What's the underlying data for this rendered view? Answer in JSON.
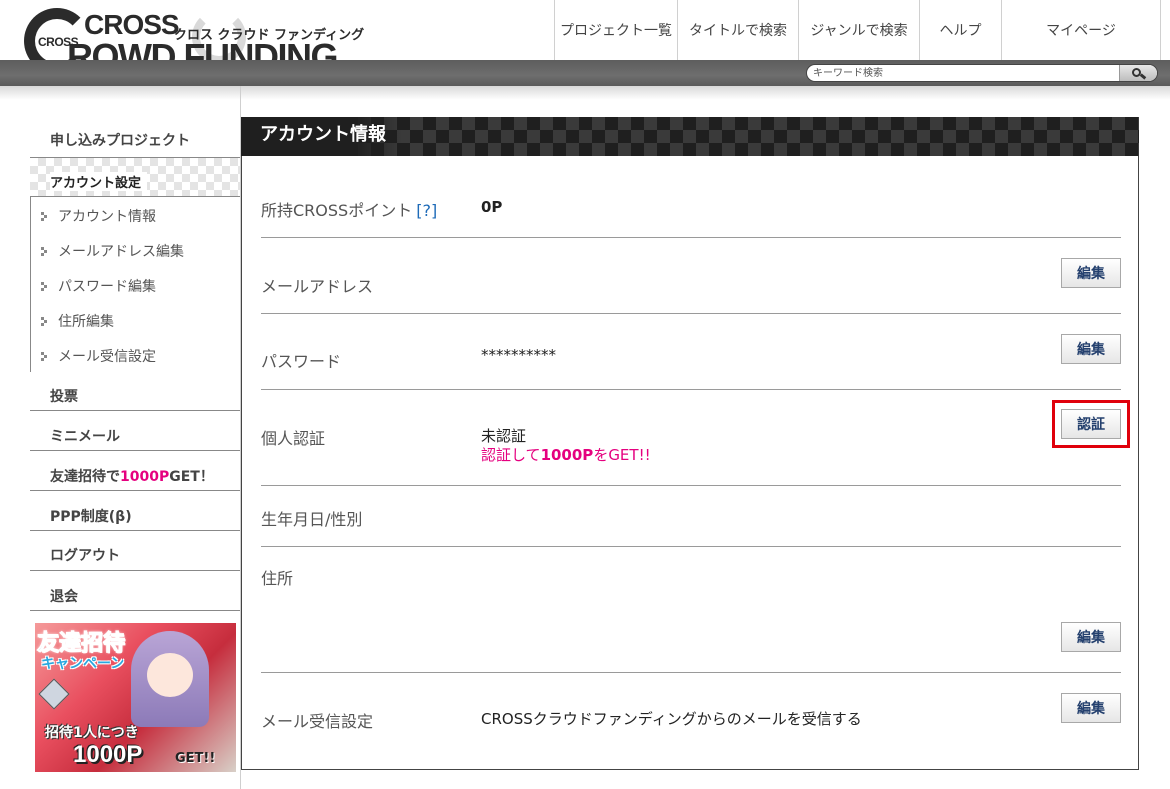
{
  "logo": {
    "badge": "CROSS",
    "line1": "CROSS",
    "line2": "ROWD FUNDING",
    "kana": "クロス クラウド ファンディング"
  },
  "global_nav": [
    {
      "label": "プロジェクト一覧"
    },
    {
      "label": "タイトルで検索"
    },
    {
      "label": "ジャンルで検索"
    },
    {
      "label": "ヘルプ"
    },
    {
      "label": "マイページ"
    }
  ],
  "search": {
    "placeholder": "キーワード検索",
    "button_icon": "search-icon"
  },
  "sidebar": {
    "applied_projects": "申し込みプロジェクト",
    "account_settings": "アカウント設定",
    "sub_items": [
      {
        "label": "アカウント情報"
      },
      {
        "label": "メールアドレス編集"
      },
      {
        "label": "パスワード編集"
      },
      {
        "label": "住所編集"
      },
      {
        "label": "メール受信設定"
      }
    ],
    "vote": "投票",
    "mini_mail": "ミニメール",
    "invite_prefix": "友達招待で",
    "invite_points": "1000P",
    "invite_suffix": "GET！",
    "ppp": "PPP制度(β)",
    "logout": "ログアウト",
    "withdraw": "退会",
    "banner": {
      "title": "友達招待",
      "subtitle": "キャンペーン",
      "line": "招待1人につき",
      "points": "1000P",
      "get": "GET!!"
    }
  },
  "main": {
    "title": "アカウント情報",
    "points": {
      "label": "所持CROSSポイント",
      "help": "[?]",
      "value": "0P"
    },
    "email": {
      "label": "メールアドレス",
      "value": "",
      "button": "編集"
    },
    "password": {
      "label": "パスワード",
      "value": "**********",
      "button": "編集"
    },
    "verification": {
      "label": "個人認証",
      "status": "未認証",
      "note_prefix": "認証して",
      "note_points": "1000P",
      "note_suffix": "をGET!!",
      "button": "認証"
    },
    "birth_gender": {
      "label": "生年月日/性別"
    },
    "address": {
      "label": "住所",
      "button": "編集"
    },
    "mail_settings": {
      "label": "メール受信設定",
      "value": "CROSSクラウドファンディングからのメールを受信する",
      "button": "編集"
    }
  },
  "colors": {
    "accent_pink": "#e5007f",
    "link_blue": "#1e6bb8",
    "highlight_red": "#e0000b",
    "button_text": "#24406e"
  }
}
